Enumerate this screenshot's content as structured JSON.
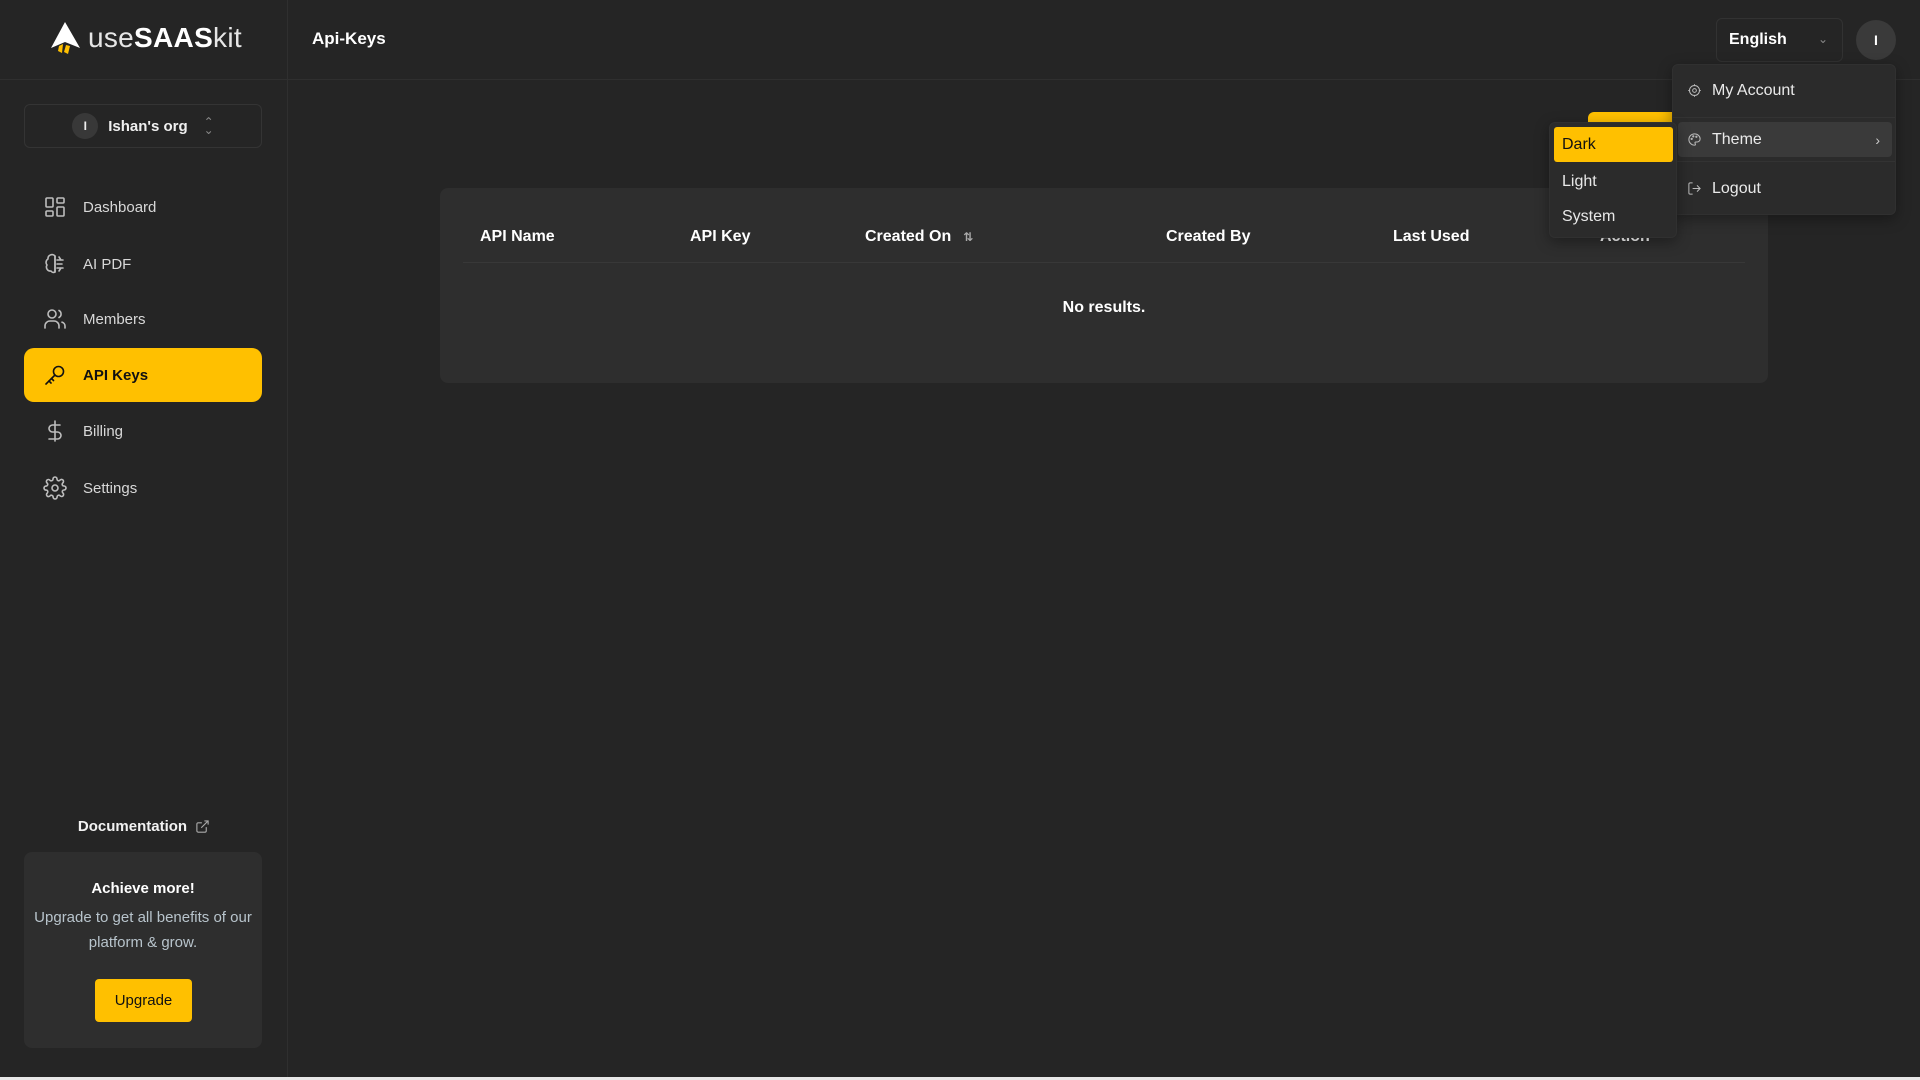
{
  "app": {
    "logo_text_light": "use",
    "logo_text_bold": "SAAS",
    "logo_text_tail": "kit",
    "accent_color": "#ffc000"
  },
  "header": {
    "title": "Api-Keys",
    "language": {
      "selected": "English"
    },
    "avatar_initial": "I"
  },
  "sidebar": {
    "org": {
      "initial": "I",
      "name": "Ishan's org"
    },
    "items": [
      {
        "label": "Dashboard",
        "icon": "dashboard-icon",
        "active": false
      },
      {
        "label": "AI PDF",
        "icon": "ai-brain-icon",
        "active": false
      },
      {
        "label": "Members",
        "icon": "members-icon",
        "active": false
      },
      {
        "label": "API Keys",
        "icon": "key-icon",
        "active": true
      },
      {
        "label": "Billing",
        "icon": "dollar-icon",
        "active": false
      },
      {
        "label": "Settings",
        "icon": "gear-icon",
        "active": false
      }
    ],
    "documentation_label": "Documentation",
    "upgrade_card": {
      "title": "Achieve more!",
      "text": "Upgrade to get all benefits of our platform & grow.",
      "button_label": "Upgrade"
    }
  },
  "table": {
    "columns": [
      "API Name",
      "API Key",
      "Created On",
      "Created By",
      "Last Used",
      "Action"
    ],
    "sortable_column": "Created On",
    "rows": [],
    "empty_message": "No results."
  },
  "account_menu": {
    "items": [
      {
        "label": "My Account",
        "icon": "account-settings-icon"
      },
      {
        "label": "Theme",
        "icon": "palette-icon",
        "has_submenu": true
      },
      {
        "label": "Logout",
        "icon": "logout-icon"
      }
    ],
    "theme_submenu": {
      "options": [
        "Dark",
        "Light",
        "System"
      ],
      "selected": "Dark"
    }
  }
}
